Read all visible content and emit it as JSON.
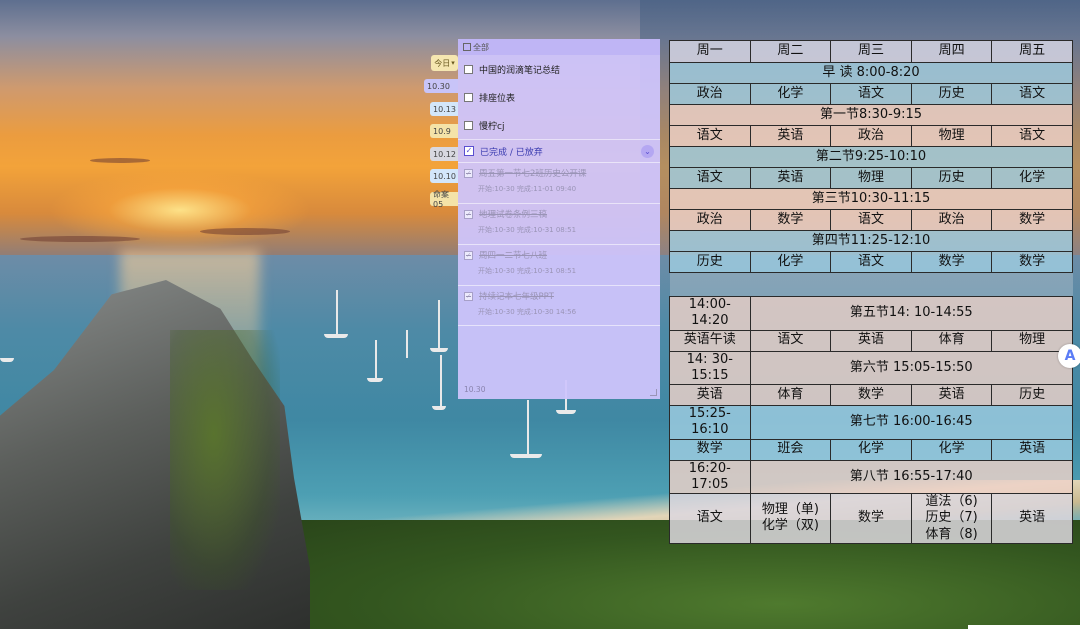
{
  "date_tabs": {
    "selector": {
      "label": "今日",
      "chevron": "chevron-down-icon"
    },
    "tabs": [
      {
        "label": "10.30",
        "color": "#c8c4f8"
      },
      {
        "label": "10.13",
        "color": "#d3e6fa"
      },
      {
        "label": "10.9",
        "color": "#f4e3a8"
      },
      {
        "label": "10.12",
        "color": "#d8d8e0"
      },
      {
        "label": "10.10",
        "color": "#d3e6fa"
      },
      {
        "label": "命案05",
        "color": "#f4e3a8"
      }
    ]
  },
  "todo": {
    "header": "全部",
    "tasks": [
      {
        "label": "中国的润滴笔记总结"
      },
      {
        "label": "排座位表"
      },
      {
        "label": "慢柠cj"
      }
    ],
    "group": {
      "label": "已完成 / 已放弃",
      "check": "✓",
      "chevron": "⌄"
    },
    "done": [
      {
        "title": "周五第一节七2班历史公开课",
        "meta": "开始:10-30  完成:11-01 09:40"
      },
      {
        "title": "地理试卷条例三稿",
        "meta": "开始:10-30  完成:10-31 08:51"
      },
      {
        "title": "周四一二节七八班",
        "meta": "开始:10-30  完成:10-31 08:51"
      },
      {
        "title": "持续记本七年级PPT",
        "meta": "开始:10-30  完成:10-30 14:56"
      }
    ],
    "footer": "10.30"
  },
  "timetable": {
    "days": [
      "周一",
      "周二",
      "周三",
      "周四",
      "周五"
    ],
    "morning_read": "早 读 8:00-8:20",
    "r1": [
      "政治",
      "化学",
      "语文",
      "历史",
      "语文"
    ],
    "p1": "第一节8:30-9:15",
    "r2": [
      "语文",
      "英语",
      "政治",
      "物理",
      "语文"
    ],
    "p2": "第二节9:25-10:10",
    "r3": [
      "语文",
      "英语",
      "物理",
      "历史",
      "化学"
    ],
    "p3": "第三节10:30-11:15",
    "r4": [
      "政治",
      "数学",
      "语文",
      "政治",
      "数学"
    ],
    "p4": "第四节11:25-12:10",
    "r5": [
      "历史",
      "化学",
      "语文",
      "数学",
      "数学"
    ],
    "t1": "14:00-14:20",
    "p5": "第五节14: 10-14:55",
    "r6": [
      "英语午读",
      "语文",
      "英语",
      "体育",
      "物理"
    ],
    "t2": "14: 30-15:15",
    "p6": "第六节 15:05-15:50",
    "r7": [
      "英语",
      "体育",
      "数学",
      "英语",
      "历史"
    ],
    "t3": "15:25-16:10",
    "p7": "第七节 16:00-16:45",
    "r8": [
      "数学",
      "班会",
      "化学",
      "化学",
      "英语"
    ],
    "t4": "16:20-17:05",
    "p8": "第八节 16:55-17:40",
    "r9": {
      "c1": "语文",
      "c2a": "物理（单)",
      "c2b": "化学（双)",
      "c3": "数学",
      "c4a": "道法（6)",
      "c4b": "历史（7)",
      "c4c": "体育（8)",
      "c5": "英语"
    }
  },
  "assistant": {
    "glyph": "A"
  }
}
